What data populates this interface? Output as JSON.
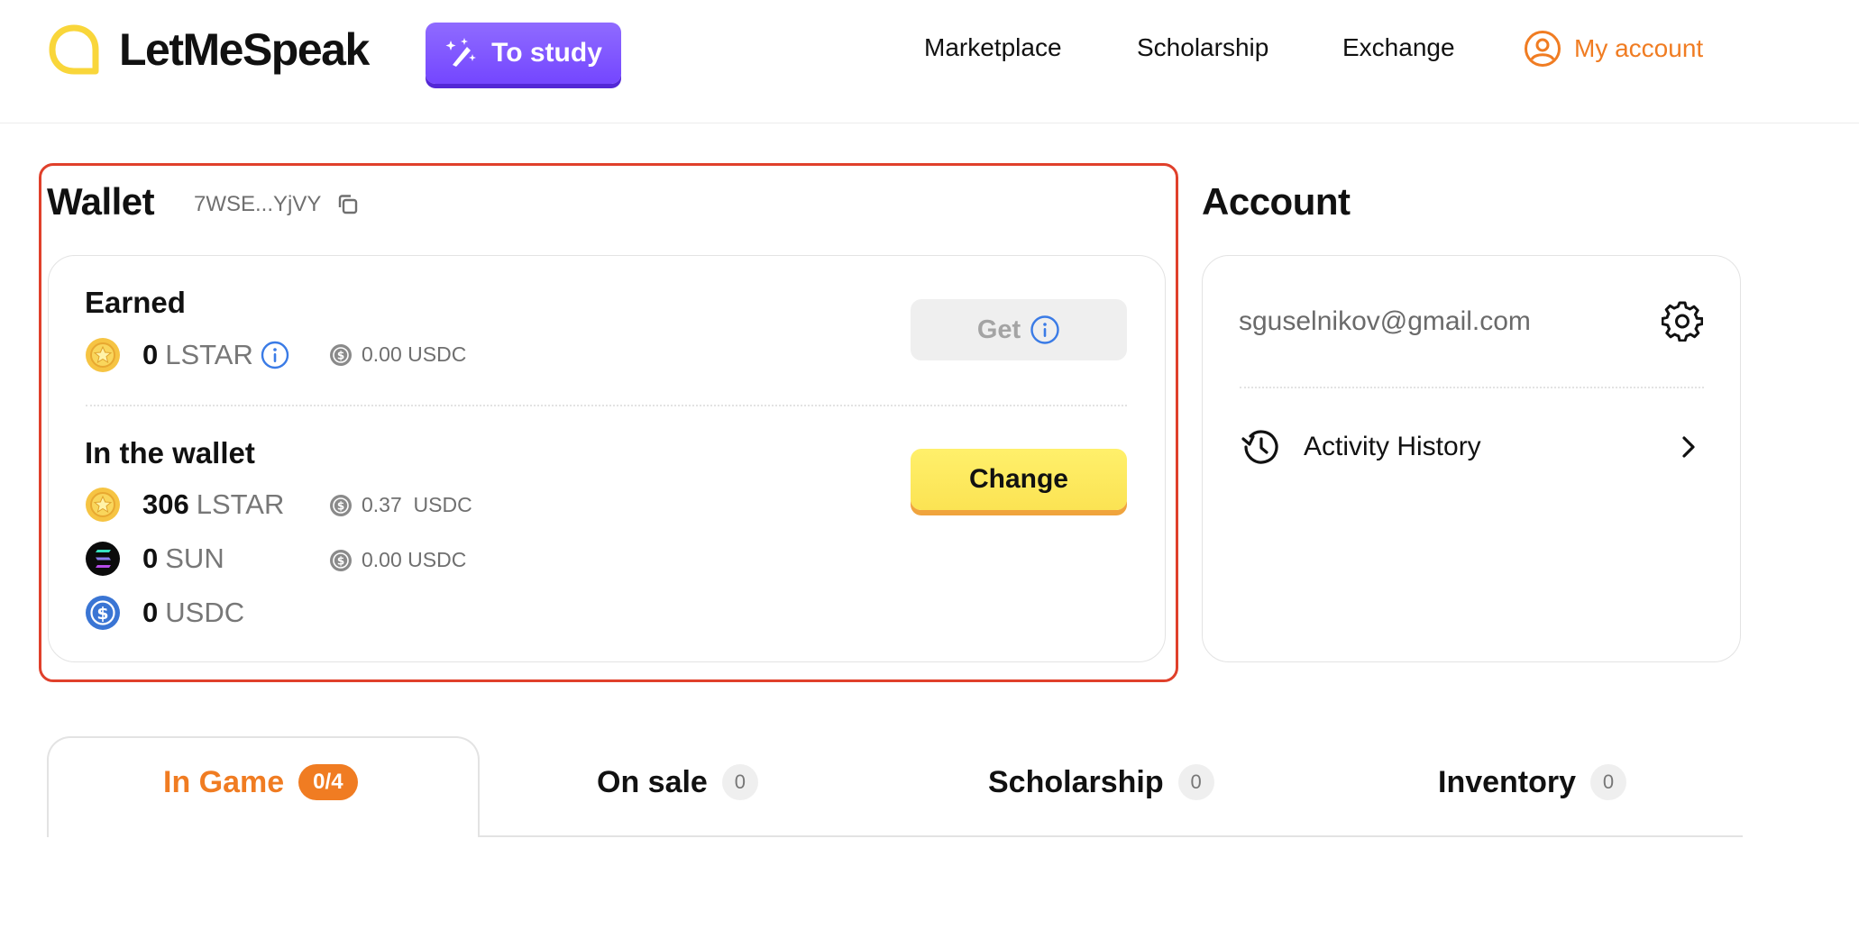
{
  "header": {
    "logo_text": "LetMeSpeak",
    "study_button": "To study",
    "nav": [
      "Marketplace",
      "Scholarship",
      "Exchange"
    ],
    "account_link": "My account"
  },
  "wallet": {
    "title": "Wallet",
    "address": "7WSE...YjVY",
    "earned": {
      "title": "Earned",
      "amount": "0",
      "currency": "LSTAR",
      "usd": "0.00 USDC",
      "get_button": "Get"
    },
    "in_wallet": {
      "title": "In the wallet",
      "change_button": "Change",
      "rows": [
        {
          "amount": "306",
          "currency": "LSTAR",
          "usd": "0.37  USDC"
        },
        {
          "amount": "0",
          "currency": "SUN",
          "usd": "0.00 USDC"
        },
        {
          "amount": "0",
          "currency": "USDC",
          "usd": ""
        }
      ]
    }
  },
  "account": {
    "title": "Account",
    "email": "sguselnikov@gmail.com",
    "activity_history": "Activity History"
  },
  "tabs": [
    {
      "label": "In Game",
      "badge": "0/4"
    },
    {
      "label": "On sale",
      "badge": "0"
    },
    {
      "label": "Scholarship",
      "badge": "0"
    },
    {
      "label": "Inventory",
      "badge": "0"
    }
  ],
  "colors": {
    "accent_orange": "#f07c22",
    "study_purple": "#7446ff",
    "change_yellow": "#fbe353",
    "highlight_red": "#e0402b",
    "logo_yellow": "#f9d63a"
  }
}
